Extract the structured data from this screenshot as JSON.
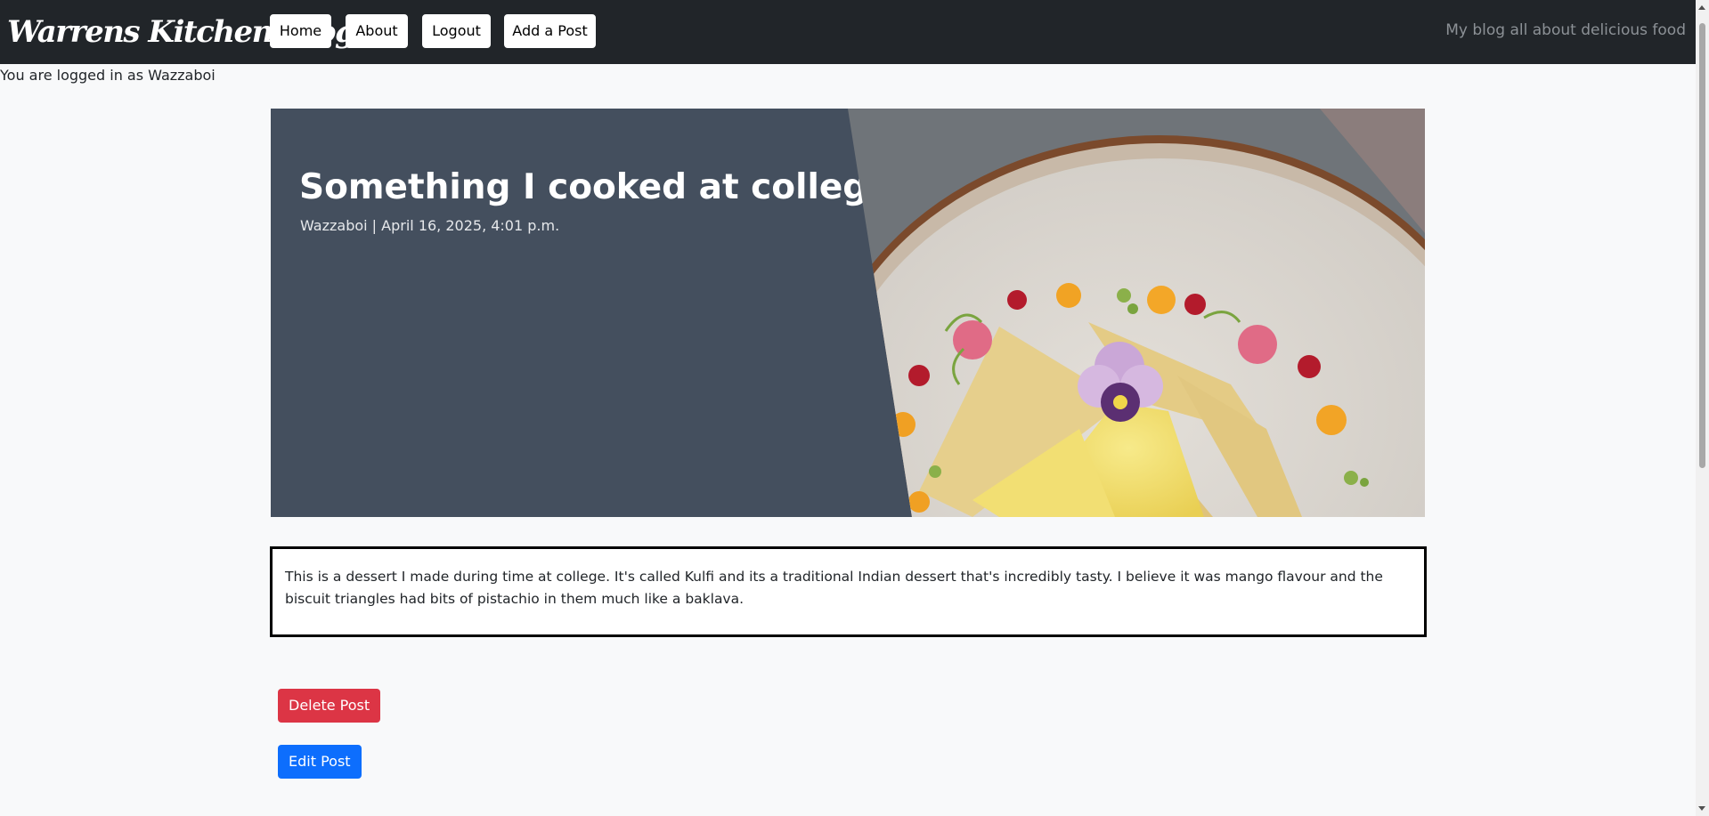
{
  "navbar": {
    "brand": "Warrens Kitchen Blog",
    "links": [
      "Home",
      "About",
      "Logout",
      "Add a Post"
    ],
    "tagline": "My blog all about delicious food"
  },
  "user_status": "You are logged in as Wazzaboi",
  "post": {
    "title": "Something I cooked at college",
    "meta": "Wazzaboi | April 16, 2025, 4:01 p.m.",
    "body": "This is a dessert I made during time at college. It's called Kulfi and its a traditional Indian dessert that's incredibly tasty. I believe it was mango flavour and the biscuit triangles had bits of pistachio in them much like a baklava."
  },
  "actions": {
    "delete_label": "Delete Post",
    "edit_label": "Edit Post"
  },
  "colors": {
    "navbar_bg": "#212529",
    "hero_bg": "#444f5e",
    "delete": "#dc3545",
    "edit": "#0d6efd"
  }
}
